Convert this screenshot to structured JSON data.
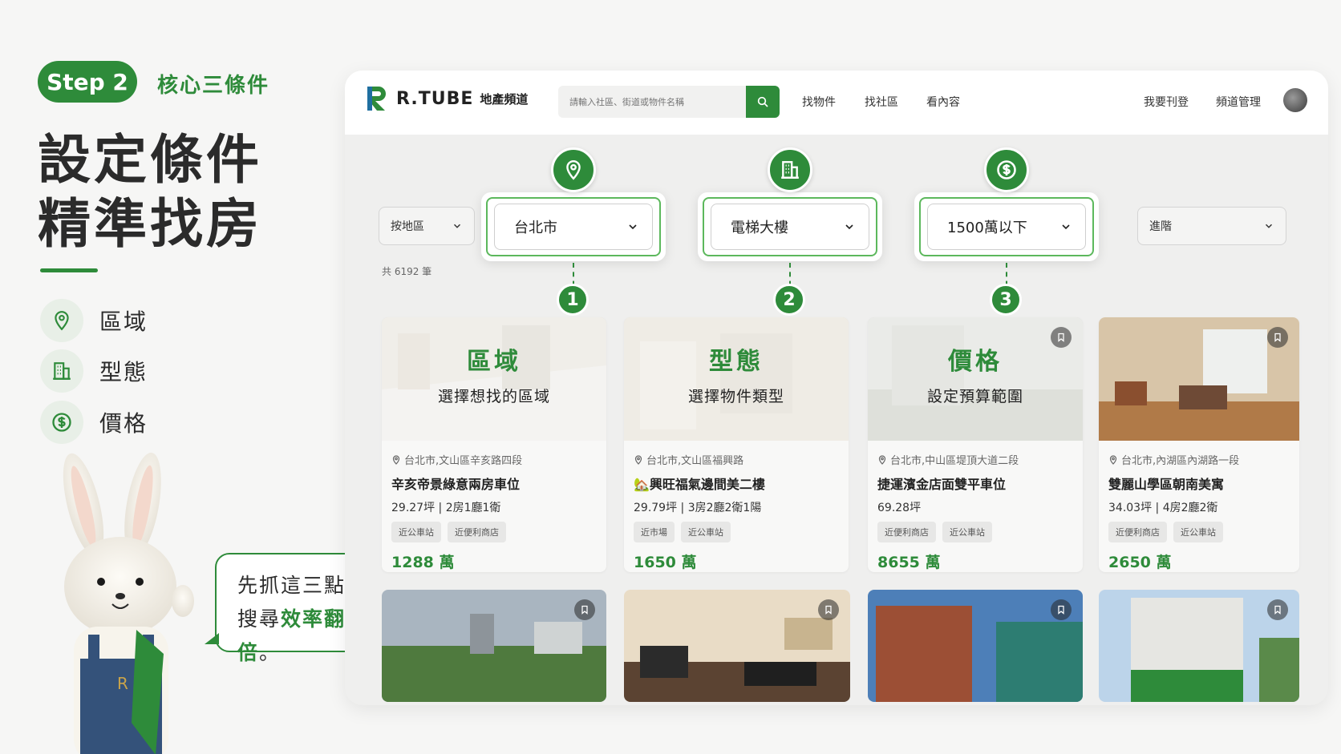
{
  "intro": {
    "step_label": "Step 2",
    "step_subtitle": "核心三條件",
    "headline_line1": "設定條件",
    "headline_line2": "精準找房",
    "conditions": [
      {
        "icon": "location-pin-icon",
        "label": "區域"
      },
      {
        "icon": "building-icon",
        "label": "型態"
      },
      {
        "icon": "dollar-circle-icon",
        "label": "價格"
      }
    ],
    "speech_line1": "先抓這三點，",
    "speech_line2_prefix": "搜尋",
    "speech_line2_emphasis": "效率翻倍",
    "speech_line2_suffix": "。"
  },
  "nav": {
    "brand": "R.TUBE",
    "brand_sub": "地產頻道",
    "search_placeholder": "請輸入社區、街道或物件名稱",
    "links": [
      "找物件",
      "找社區",
      "看內容"
    ],
    "right_links": [
      "我要刊登",
      "頻道管理"
    ]
  },
  "filters": {
    "area_mode": "按地區",
    "city": "台北市",
    "type": "電梯大樓",
    "price": "1500萬以下",
    "advanced": "進階"
  },
  "result_count": "共 6192 筆",
  "callouts": [
    {
      "num": "1",
      "title": "區域",
      "desc": "選擇想找的區域"
    },
    {
      "num": "2",
      "title": "型態",
      "desc": "選擇物件類型"
    },
    {
      "num": "3",
      "title": "價格",
      "desc": "設定預算範圍"
    }
  ],
  "listings": [
    {
      "location": "台北市,文山區辛亥路四段",
      "title": "辛亥帝景綠意兩房車位",
      "spec": "29.27坪 | 2房1廳1衛",
      "tags": [
        "近公車站",
        "近便利商店"
      ],
      "price": "1288 萬"
    },
    {
      "location": "台北市,文山區福興路",
      "title": "🏡興旺福氣邊間美二樓",
      "spec": "29.79坪 | 3房2廳2衛1陽",
      "tags": [
        "近市場",
        "近公車站"
      ],
      "price": "1650 萬"
    },
    {
      "location": "台北市,中山區堤頂大道二段",
      "title": "捷運濱金店面雙平車位",
      "spec": "69.28坪",
      "tags": [
        "近便利商店",
        "近公車站"
      ],
      "price": "8655 萬"
    },
    {
      "location": "台北市,內湖區內湖路一段",
      "title": "雙麗山學區朝南美寓",
      "spec": "34.03坪 | 4房2廳2衛",
      "tags": [
        "近便利商店",
        "近公車站"
      ],
      "price": "2650 萬"
    }
  ],
  "colors": {
    "brand_green": "#2e8b3a",
    "light_green": "#5cb85c"
  }
}
